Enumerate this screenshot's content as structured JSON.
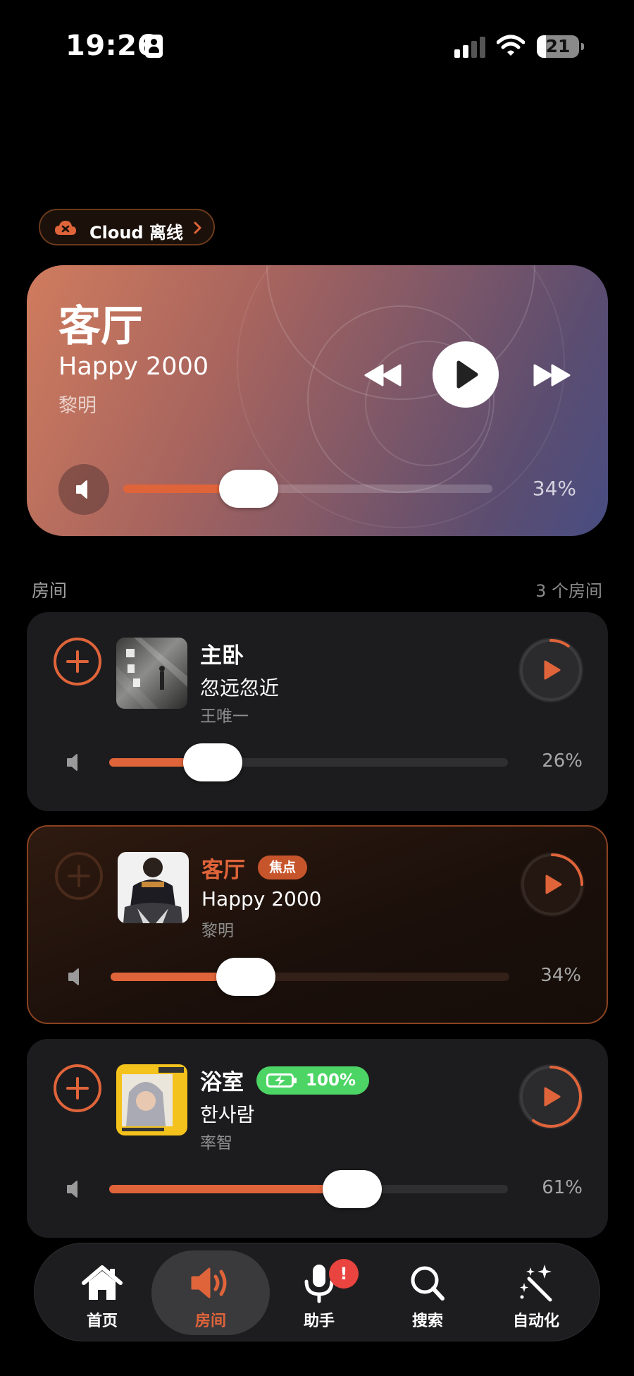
{
  "status_bar": {
    "time": "19:26",
    "battery": "21"
  },
  "cloud": {
    "label": "Cloud 离线"
  },
  "hero": {
    "room": "客厅",
    "song": "Happy 2000",
    "artist": "黎明",
    "volume_pct": 34,
    "volume_text": "34%"
  },
  "rooms_header": {
    "title": "房间",
    "count": "3 个房间"
  },
  "rooms": [
    {
      "name": "主卧",
      "song": "忽远忽近",
      "artist": "王唯一",
      "volume_pct": 26,
      "volume_text": "26%",
      "play_progress": 0.1
    },
    {
      "name": "客厅",
      "badge": "焦点",
      "song": "Happy 2000",
      "artist": "黎明",
      "volume_pct": 34,
      "volume_text": "34%",
      "play_progress": 0.25
    },
    {
      "name": "浴室",
      "battery_badge": "100%",
      "song": "한사람",
      "artist": "率智",
      "volume_pct": 61,
      "volume_text": "61%",
      "play_progress": 0.6
    }
  ],
  "tabs": [
    {
      "label": "首页",
      "icon": "house-icon"
    },
    {
      "label": "房间",
      "icon": "speaker-icon",
      "active": true
    },
    {
      "label": "助手",
      "icon": "microphone-icon",
      "badge": "!"
    },
    {
      "label": "搜索",
      "icon": "magnifier-icon"
    },
    {
      "label": "自动化",
      "icon": "magic-wand-icon"
    }
  ],
  "colors": {
    "accent": "#e0643a",
    "background": "#000000",
    "card": "#1c1c1e",
    "battery_green": "#4cd464",
    "alert_red": "#e9443f"
  }
}
